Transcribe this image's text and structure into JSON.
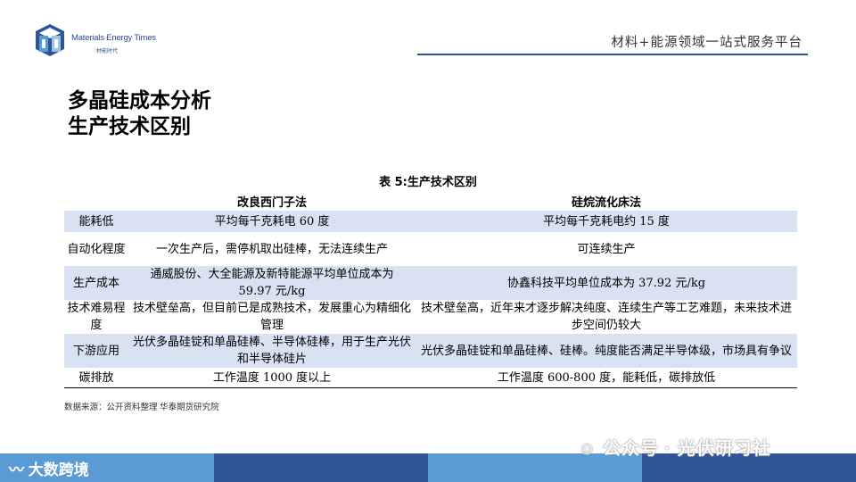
{
  "header": {
    "brand": "Materials Energy Times",
    "brand_sub": "材能时代",
    "tagline": "材料+能源领域一站式服务平台"
  },
  "title": {
    "line1": "多晶硅成本分析",
    "line2": "生产技术区别"
  },
  "table": {
    "caption": "表 5:生产技术区别",
    "columns": [
      "",
      "改良西门子法",
      "硅烷流化床法"
    ],
    "rows": [
      {
        "label": "能耗低",
        "a": "平均每千克耗电 60 度",
        "b": "平均每千克耗电约 15 度"
      },
      {
        "label": "自动化程度",
        "a": "一次生产后，需停机取出硅棒，无法连续生产",
        "b": "可连续生产"
      },
      {
        "label": "生产成本",
        "a": "通威股份、大全能源及新特能源平均单位成本为 59.97 元/kg",
        "b": "协鑫科技平均单位成本为 37.92 元/kg"
      },
      {
        "label": "技术难易程度",
        "a": "技术壁垒高，但目前已是成熟技术，发展重心为精细化管理",
        "b": "技术壁垒高，近年来才逐步解决纯度、连续生产等工艺难题，未来技术进步空间仍较大"
      },
      {
        "label": "下游应用",
        "a": "光伏多晶硅锭和单晶硅棒、半导体硅棒，用于生产光伏和半导体硅片",
        "b": "光伏多晶硅锭和单晶硅棒、硅棒。纯度能否满足半导体级，市场具有争议"
      },
      {
        "label": "碳排放",
        "a": "工作温度 1000 度以上",
        "b": "工作温度 600-800 度，能耗低，碳排放低"
      }
    ]
  },
  "source": "数据来源：公开资料整理  华泰期货研究院",
  "watermarks": {
    "left": "大数跨境",
    "right": "公众号 · 光伏研习社"
  },
  "colors": {
    "accent": "#2f5597",
    "row_shade": "#d9e2f3",
    "footer_light": "#5b9bd5",
    "footer_dark": "#2f5597"
  }
}
